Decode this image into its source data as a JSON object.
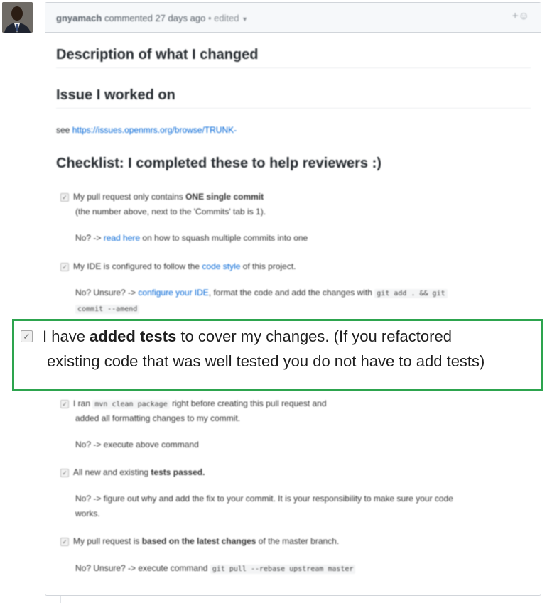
{
  "comment": {
    "author": "gnyamach",
    "action": "commented",
    "time": "27 days ago",
    "edited": "• edited",
    "reaction_icon": "+☺"
  },
  "content": {
    "h_description": "Description of what I changed",
    "h_issue": "Issue I worked on",
    "see_label": "see",
    "issue_link": "https://issues.openmrs.org/browse/TRUNK-",
    "h_checklist": "Checklist: I completed these to help reviewers :)",
    "item1_pre": "My pull request only contains",
    "item1_bold": "ONE single commit",
    "item1_line2": "(the number above, next to the 'Commits' tab is 1).",
    "item1_no_pre": "No? ->",
    "item1_no_link": "read here",
    "item1_no_post": "on how to squash multiple commits into one",
    "item2_pre": "My IDE is configured to follow the",
    "item2_link": "code style",
    "item2_post": "of this project.",
    "item2_no_pre": "No? Unsure? ->",
    "item2_no_link": "configure your IDE",
    "item2_no_post": ", format the code and add the changes with",
    "item2_code1": "git add . && git",
    "item2_code2": "commit --amend",
    "item4_pre": "I ran",
    "item4_code": "mvn clean package",
    "item4_post": "right before creating this pull request and",
    "item4_line2": "added all formatting changes to my commit.",
    "item4_no": "No? -> execute above command",
    "item5_pre": "All new and existing",
    "item5_bold": "tests passed.",
    "item5_no": "No? -> figure out why and add the fix to your commit. It is your responsibility to make sure your code",
    "item5_no2": "works.",
    "item6_pre": "My pull request is",
    "item6_bold": "based on the latest changes",
    "item6_post": "of the master branch.",
    "item6_no": "No? Unsure? -> execute command",
    "item6_code": "git pull --rebase upstream master"
  },
  "highlight": {
    "pre": "I have ",
    "bold": "added tests",
    "post": " to cover my changes. (If you refactored",
    "line2": "existing code that was well tested you do not have to add tests)"
  }
}
